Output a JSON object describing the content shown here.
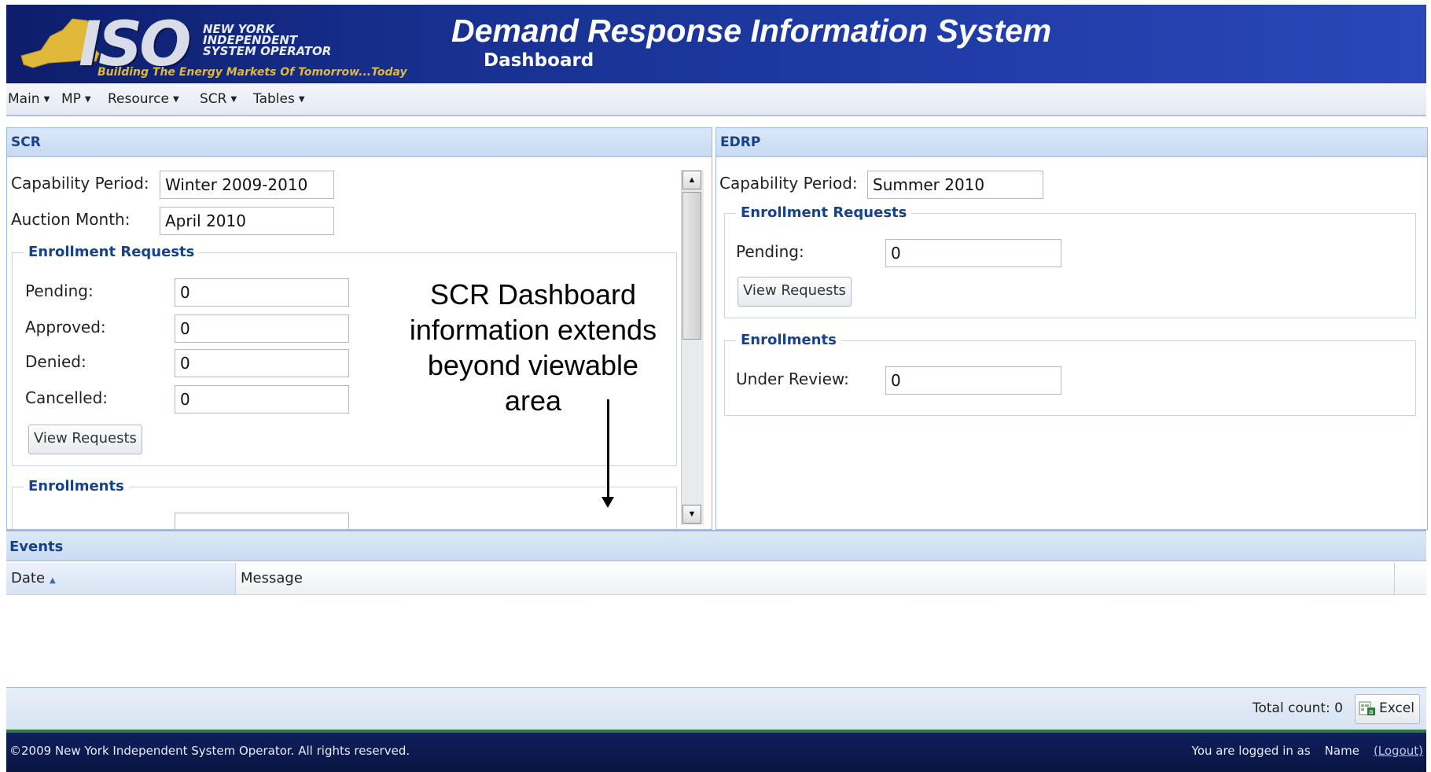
{
  "header": {
    "logo_iso": "ISO",
    "logo_org_lines": [
      "NEW YORK",
      "INDEPENDENT",
      "SYSTEM OPERATOR"
    ],
    "logo_tagline": "Building The Energy Markets Of Tomorrow...Today",
    "title": "Demand Response Information System",
    "subtitle": "Dashboard"
  },
  "menu": [
    {
      "label": "Main"
    },
    {
      "label": "MP"
    },
    {
      "label": "Resource"
    },
    {
      "label": "SCR"
    },
    {
      "label": "Tables"
    }
  ],
  "scr": {
    "title": "SCR",
    "capability_period_label": "Capability Period:",
    "capability_period_value": "Winter 2009-2010",
    "auction_month_label": "Auction Month:",
    "auction_month_value": "April 2010",
    "enrollment_requests_legend": "Enrollment Requests",
    "pending_label": "Pending:",
    "pending_value": "0",
    "approved_label": "Approved:",
    "approved_value": "0",
    "denied_label": "Denied:",
    "denied_value": "0",
    "cancelled_label": "Cancelled:",
    "cancelled_value": "0",
    "view_requests_label": "View Requests",
    "enrollments_legend": "Enrollments"
  },
  "annotation": {
    "lines": [
      "SCR Dashboard",
      "information extends",
      "beyond viewable",
      "area"
    ]
  },
  "edrp": {
    "title": "EDRP",
    "capability_period_label": "Capability Period:",
    "capability_period_value": "Summer 2010",
    "enrollment_requests_legend": "Enrollment Requests",
    "pending_label": "Pending:",
    "pending_value": "0",
    "view_requests_label": "View Requests",
    "enrollments_legend": "Enrollments",
    "under_review_label": "Under Review:",
    "under_review_value": "0"
  },
  "events": {
    "title": "Events",
    "columns": [
      "Date",
      "Message"
    ],
    "rows": [],
    "total_count_label": "Total count: 0",
    "excel_label": "Excel"
  },
  "footer": {
    "copyright": "©2009   New York Independent System Operator. All rights reserved.",
    "logged_in_label": "You are logged in as",
    "user_name": "Name",
    "logout_label": "(Logout)"
  },
  "colors": {
    "header_blue": "#17308f",
    "panel_title_text": "#15428b",
    "panel_border": "#99bbe8",
    "footer_green": "#2f7a3f"
  }
}
